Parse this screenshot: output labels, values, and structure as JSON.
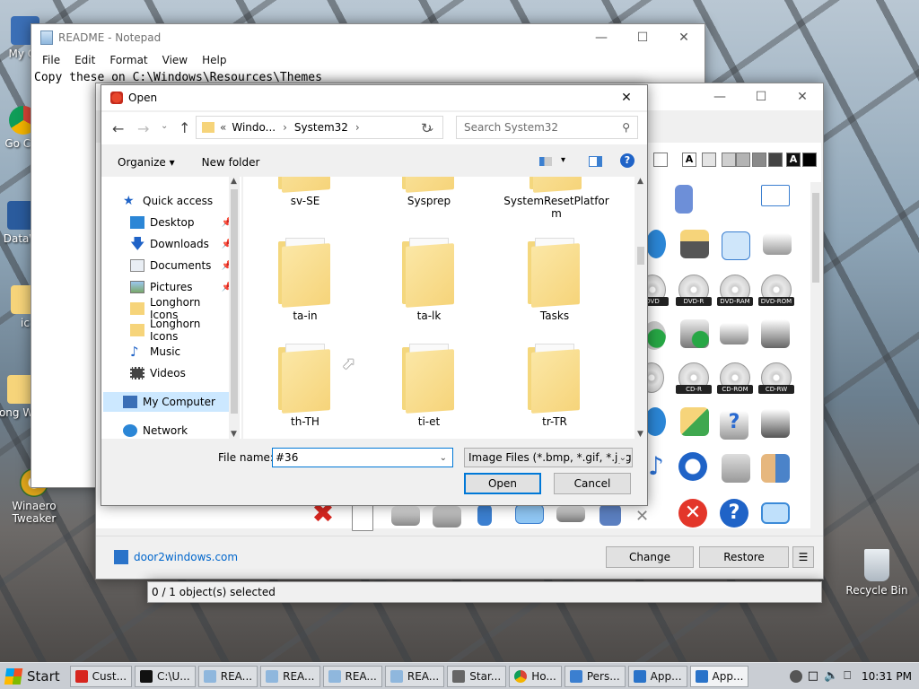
{
  "desktop": {
    "icons": [
      {
        "label": "My Co",
        "icon": "computer-icon"
      },
      {
        "label": "Go Chr",
        "icon": "chrome-icon"
      },
      {
        "label": "DataW",
        "icon": "app-icon"
      },
      {
        "label": "ic",
        "icon": "folder-icon"
      },
      {
        "label": "Long Wind",
        "icon": "folder-icon"
      },
      {
        "label": "Winaero Tweaker",
        "icon": "winaero-icon"
      },
      {
        "label": "Recycle Bin",
        "icon": "recycle-bin-icon"
      }
    ]
  },
  "notepad": {
    "title": "README - Notepad",
    "menu": [
      "File",
      "Edit",
      "Format",
      "View",
      "Help"
    ],
    "text": "Copy these on C:\\Windows\\Resources\\Themes"
  },
  "app_window": {
    "website": "door2windows.com",
    "change_label": "Change",
    "restore_label": "Restore",
    "menu_label": "☰",
    "status": "0 / 1 object(s) selected",
    "disc_labels": [
      "DVD",
      "DVD-R",
      "DVD-RAM",
      "DVD-ROM",
      "CD-R",
      "CD-ROM",
      "CD-RW"
    ],
    "swatch_letters": [
      "A",
      "A"
    ]
  },
  "open_dialog": {
    "title": "Open",
    "breadcrumb": [
      "«",
      "Windo...",
      "System32"
    ],
    "search_placeholder": "Search System32",
    "organize_label": "Organize ▾",
    "new_folder_label": "New folder",
    "nav": [
      {
        "label": "Quick access",
        "icon": "star-icon"
      },
      {
        "label": "Desktop",
        "icon": "desktop-icon",
        "pinned": true
      },
      {
        "label": "Downloads",
        "icon": "download-icon",
        "pinned": true
      },
      {
        "label": "Documents",
        "icon": "documents-icon",
        "pinned": true
      },
      {
        "label": "Pictures",
        "icon": "pictures-icon",
        "pinned": true
      },
      {
        "label": "Longhorn Icons",
        "icon": "folder-icon"
      },
      {
        "label": "Longhorn Icons",
        "icon": "folder-icon"
      },
      {
        "label": "Music",
        "icon": "music-icon"
      },
      {
        "label": "Videos",
        "icon": "videos-icon"
      },
      {
        "label": "My Computer",
        "icon": "computer-icon",
        "selected": true
      },
      {
        "label": "Network",
        "icon": "network-icon"
      }
    ],
    "folders_row1": [
      "sv-SE",
      "Sysprep",
      "SystemResetPlatform"
    ],
    "folders_row2": [
      "ta-in",
      "ta-lk",
      "Tasks"
    ],
    "folders_row3": [
      "th-TH",
      "ti-et",
      "tr-TR"
    ],
    "file_name_label": "File name:",
    "file_name_value": "#36",
    "file_type": "Image Files (*.bmp, *.gif, *.jpg,",
    "open_label": "Open",
    "cancel_label": "Cancel"
  },
  "taskbar": {
    "start_label": "Start",
    "items": [
      "Cust...",
      "C:\\U...",
      "REA...",
      "REA...",
      "REA...",
      "REA...",
      "Star...",
      "Ho...",
      "Pers...",
      "App...",
      "App..."
    ],
    "clock": "10:31 PM"
  },
  "colors": {
    "accent": "#0078d7",
    "selection": "#cce8ff",
    "folder": "#f6d47a"
  }
}
